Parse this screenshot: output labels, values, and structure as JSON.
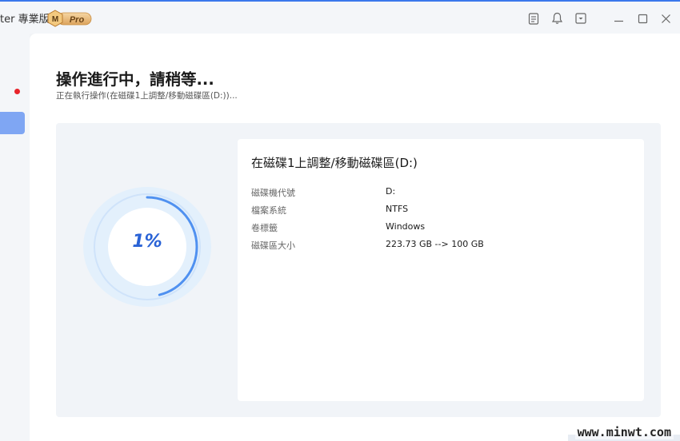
{
  "app": {
    "title": "ter 專業版",
    "badge_letter": "M",
    "badge_text": "Pro"
  },
  "titlebar_icons": [
    "note-icon",
    "bell-icon",
    "dropdown-icon",
    "minimize-icon",
    "maximize-icon",
    "close-icon"
  ],
  "main": {
    "heading": "操作進行中，請稍等...",
    "subtext": "正在執行操作(在磁碟1上調整/移動磁碟區(D:))..."
  },
  "progress": {
    "percent_label": "1%",
    "value": 0.01
  },
  "details": {
    "title": "在磁碟1上調整/移動磁碟區(D:)",
    "rows": [
      {
        "label": "磁碟機代號",
        "value": "D:"
      },
      {
        "label": "檔案系統",
        "value": "NTFS"
      },
      {
        "label": "卷標籤",
        "value": "Windows"
      },
      {
        "label": "磁碟區大小",
        "value": "223.73 GB --> 100 GB"
      }
    ]
  },
  "watermark": "www.minwt.com",
  "colors": {
    "accent": "#3b78ec",
    "ring_progress": "#3f86ee",
    "ring_track": "#e3f0fc",
    "active_nav": "#7fa6f3",
    "notification_dot": "#e8242b"
  }
}
